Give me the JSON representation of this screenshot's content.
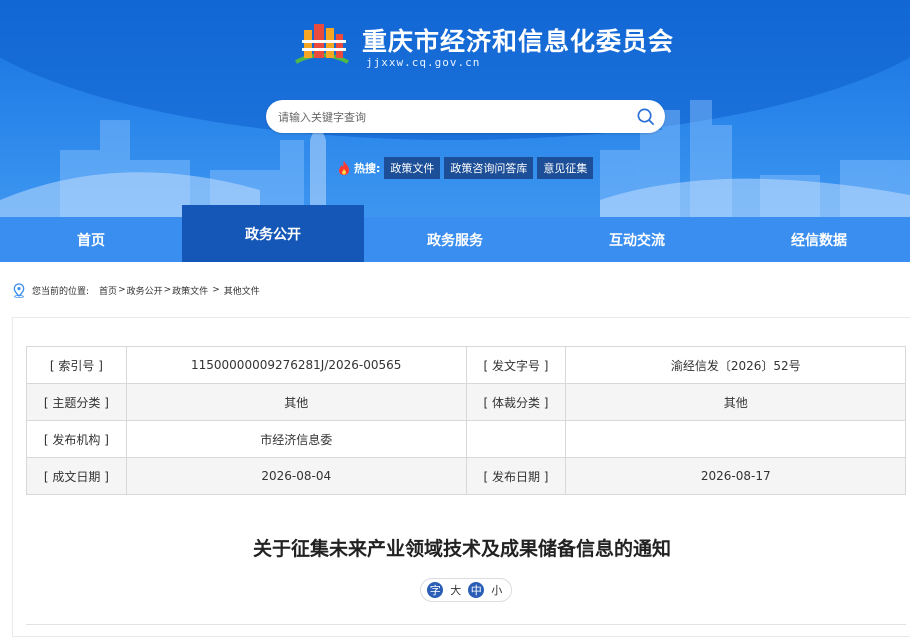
{
  "header": {
    "site_title": "重庆市经济和信息化委员会",
    "site_domain": "jjxxw.cq.gov.cn",
    "logo_icon": "building-logo-icon",
    "colors": {
      "banner": "#2a86ea",
      "nav": "#3a8ef0",
      "nav_active": "#1457b6",
      "hot_tag": "#1c4f97"
    }
  },
  "search": {
    "placeholder": "请输入关键字查询",
    "value": "",
    "icon": "search-icon"
  },
  "hot": {
    "label": "热搜:",
    "tags": [
      "政策文件",
      "政策咨询问答库",
      "意见征集"
    ]
  },
  "nav": {
    "items": [
      "首页",
      "政务公开",
      "政务服务",
      "互动交流",
      "经信数据"
    ],
    "active": "政务公开"
  },
  "breadcrumb": {
    "prefix": "您当前的位置:",
    "items": [
      "首页",
      "政务公开",
      "政策文件",
      "其他文件"
    ],
    "seps": [
      ">",
      ">",
      ">"
    ]
  },
  "meta": {
    "rows": [
      {
        "k1": "[ 索引号 ]",
        "v1": "11500000009276281J/2026-00565",
        "k2": "[ 发文字号 ]",
        "v2": "渝经信发〔2026〕52号"
      },
      {
        "k1": "[ 主题分类 ]",
        "v1": "其他",
        "k2": "[ 体裁分类 ]",
        "v2": "其他"
      },
      {
        "k1": "[ 发布机构 ]",
        "v1": "市经济信息委",
        "k2": "",
        "v2": ""
      },
      {
        "k1": "[ 成文日期 ]",
        "v1": "2026-08-04",
        "k2": "[ 发布日期 ]",
        "v2": "2026-08-17"
      }
    ]
  },
  "document": {
    "title": "关于征集未来产业领域技术及成果储备信息的通知"
  },
  "font_size": {
    "prefix": "字",
    "options": [
      "大",
      "中",
      "小"
    ],
    "selected": "中"
  }
}
